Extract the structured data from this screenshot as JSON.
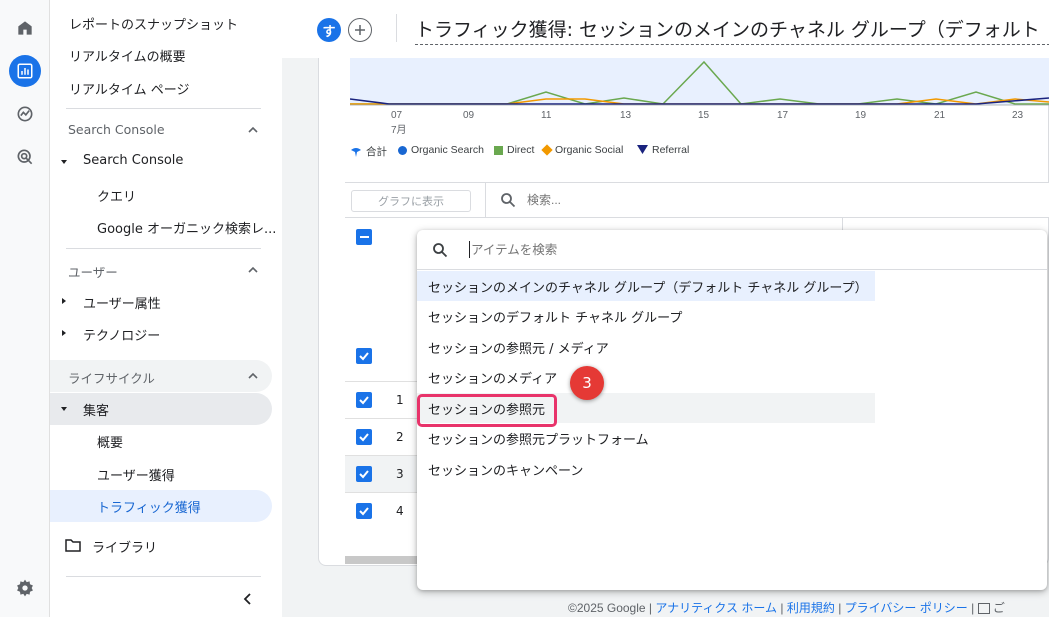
{
  "rail": {
    "items": [
      {
        "icon": "home-icon"
      },
      {
        "icon": "reports-icon",
        "active": true
      },
      {
        "icon": "explore-icon"
      },
      {
        "icon": "advertising-icon"
      }
    ],
    "settings_icon": "gear-icon"
  },
  "sidebar": {
    "top_items": [
      "レポートのスナップショット",
      "リアルタイムの概要",
      "リアルタイム ページ"
    ],
    "search_console_section": "Search Console",
    "search_console_group": "Search Console",
    "search_console_children": [
      "クエリ",
      "Google オーガニック検索レ..."
    ],
    "user_section": "ユーザー",
    "user_items": [
      "ユーザー属性",
      "テクノロジー"
    ],
    "lifecycle_section": "ライフサイクル",
    "acquisition_group": "集客",
    "acquisition_children": [
      "概要",
      "ユーザー獲得",
      "トラフィック獲得"
    ],
    "library": "ライブラリ"
  },
  "header": {
    "avatar_letter": "す",
    "title": "トラフィック獲得: セッションのメインのチャネル グループ（デフォルト"
  },
  "chart": {
    "x_ticks": [
      "07",
      "09",
      "11",
      "13",
      "15",
      "17",
      "19",
      "21",
      "23"
    ],
    "month_label": "7月",
    "legend": [
      "合計",
      "Organic Search",
      "Direct",
      "Organic Social",
      "Referral"
    ],
    "colors": {
      "total": "#1a73e8",
      "organic_search": "#1967d2",
      "direct": "#6aa84f",
      "organic_social": "#f29900",
      "referral": "#1a237e"
    }
  },
  "toolbar": {
    "graph_button": "グラフに表示",
    "search_placeholder": "検索..."
  },
  "table": {
    "rows": [
      "1",
      "2",
      "3",
      "4"
    ]
  },
  "dropdown": {
    "search_placeholder": "アイテムを検索",
    "items": [
      "セッションのメインのチャネル グループ（デフォルト チャネル グループ）",
      "セッションのデフォルト チャネル グループ",
      "セッションの参照元 / メディア",
      "セッションのメディア",
      "セッションの参照元",
      "セッションの参照元プラットフォーム",
      "セッションのキャンペーン"
    ]
  },
  "annotation": {
    "step": "3"
  },
  "footer": {
    "copyright": "©2025 Google",
    "links": [
      "アナリティクス ホーム",
      "利用規約",
      "プライバシー ポリシー"
    ],
    "feedback": "ご"
  }
}
